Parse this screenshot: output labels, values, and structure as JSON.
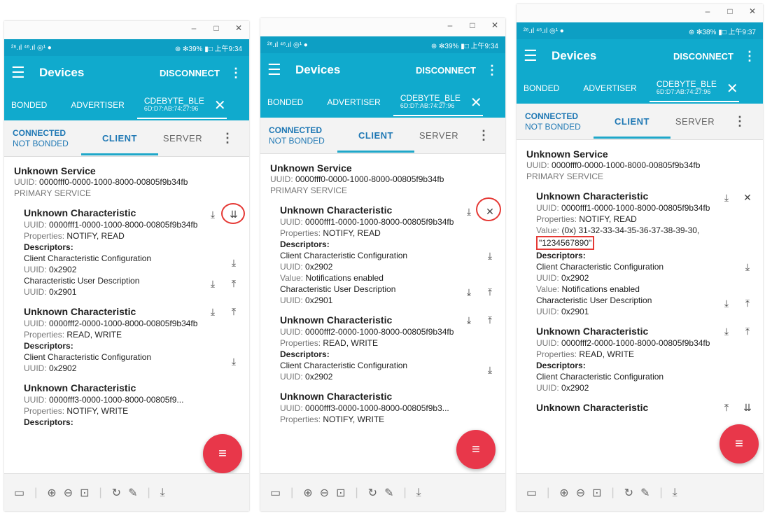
{
  "panels": [
    {
      "status_left": "²⁶.ıl ⁴⁶.ıl ◎¹ ●",
      "status_right": "⊛ ✻39% ▮□ 上午9:34",
      "title": "Devices",
      "disconnect": "DISCONNECT",
      "tabs": {
        "bonded": "BONDED",
        "advertiser": "ADVERTISER",
        "device_name": "CDEBYTE_BLE",
        "device_addr": "6D:D7:AB:74:27:96"
      },
      "conn_line1": "CONNECTED",
      "conn_line2": "NOT BONDED",
      "client": "CLIENT",
      "server": "SERVER",
      "service": {
        "title": "Unknown Service",
        "uuid_label": "UUID:",
        "uuid": "0000fff0-0000-1000-8000-00805f9b34fb",
        "type": "PRIMARY SERVICE"
      },
      "chars": [
        {
          "title": "Unknown Characteristic",
          "uuid": "0000fff1-0000-1000-8000-00805f9b34fb",
          "props": "NOTIFY, READ",
          "descriptors_label": "Descriptors:",
          "d1": "Client Characteristic Configuration",
          "d1_uuid": "0x2902",
          "d2": "Characteristic User Description",
          "d2_uuid": "0x2901"
        },
        {
          "title": "Unknown Characteristic",
          "uuid": "0000fff2-0000-1000-8000-00805f9b34fb",
          "props": "READ, WRITE",
          "descriptors_label": "Descriptors:",
          "d1": "Client Characteristic Configuration",
          "d1_uuid": "0x2902"
        },
        {
          "title": "Unknown Characteristic",
          "uuid": "0000fff3-0000-1000-8000-00805f9...",
          "props": "NOTIFY, WRITE",
          "descriptors_label": "Descriptors:"
        }
      ]
    },
    {
      "status_left": "²⁶.ıl ⁴⁶.ıl ◎¹ ●",
      "status_right": "⊛ ✻39% ▮□ 上午9:34",
      "title": "Devices",
      "disconnect": "DISCONNECT",
      "tabs": {
        "bonded": "BONDED",
        "advertiser": "ADVERTISER",
        "device_name": "CDEBYTE_BLE",
        "device_addr": "6D:D7:AB:74:27:96"
      },
      "conn_line1": "CONNECTED",
      "conn_line2": "NOT BONDED",
      "client": "CLIENT",
      "server": "SERVER",
      "service": {
        "title": "Unknown Service",
        "uuid_label": "UUID:",
        "uuid": "0000fff0-0000-1000-8000-00805f9b34fb",
        "type": "PRIMARY SERVICE"
      },
      "chars": [
        {
          "title": "Unknown Characteristic",
          "uuid": "0000fff1-0000-1000-8000-00805f9b34fb",
          "props": "NOTIFY, READ",
          "descriptors_label": "Descriptors:",
          "d1": "Client Characteristic Configuration",
          "d1_uuid": "0x2902",
          "d1_value": "Notifications enabled",
          "d2": "Characteristic User Description",
          "d2_uuid": "0x2901"
        },
        {
          "title": "Unknown Characteristic",
          "uuid": "0000fff2-0000-1000-8000-00805f9b34fb",
          "props": "READ, WRITE",
          "descriptors_label": "Descriptors:",
          "d1": "Client Characteristic Configuration",
          "d1_uuid": "0x2902"
        },
        {
          "title": "Unknown Characteristic",
          "uuid": "0000fff3-0000-1000-8000-00805f9b3...",
          "props": "NOTIFY, WRITE"
        }
      ]
    },
    {
      "status_left": "²⁶.ıl ⁴⁶.ıl ◎¹ ●",
      "status_right": "⊛ ✻38% ▮□ 上午9:37",
      "title": "Devices",
      "disconnect": "DISCONNECT",
      "tabs": {
        "bonded": "BONDED",
        "advertiser": "ADVERTISER",
        "device_name": "CDEBYTE_BLE",
        "device_addr": "6D:D7:AB:74:27:96"
      },
      "conn_line1": "CONNECTED",
      "conn_line2": "NOT BONDED",
      "client": "CLIENT",
      "server": "SERVER",
      "service": {
        "title": "Unknown Service",
        "uuid_label": "UUID:",
        "uuid": "0000fff0-0000-1000-8000-00805f9b34fb",
        "type": "PRIMARY SERVICE"
      },
      "chars": [
        {
          "title": "Unknown Characteristic",
          "uuid": "0000fff1-0000-1000-8000-00805f9b34fb",
          "props": "NOTIFY, READ",
          "value_label": "Value:",
          "value_hex": "(0x) 31-32-33-34-35-36-37-38-39-30,",
          "value_str": "\"1234567890\"",
          "descriptors_label": "Descriptors:",
          "d1": "Client Characteristic Configuration",
          "d1_uuid": "0x2902",
          "d1_value": "Notifications enabled",
          "d2": "Characteristic User Description",
          "d2_uuid": "0x2901"
        },
        {
          "title": "Unknown Characteristic",
          "uuid": "0000fff2-0000-1000-8000-00805f9b34fb",
          "props": "READ, WRITE",
          "descriptors_label": "Descriptors:",
          "d1": "Client Characteristic Configuration",
          "d1_uuid": "0x2902"
        },
        {
          "title": "Unknown Characteristic"
        }
      ]
    }
  ],
  "labels": {
    "uuid": "UUID:",
    "properties": "Properties:",
    "value": "Value:"
  },
  "colors": {
    "primary": "#10aacd",
    "fab": "#e8374a",
    "highlight": "#e53935"
  }
}
